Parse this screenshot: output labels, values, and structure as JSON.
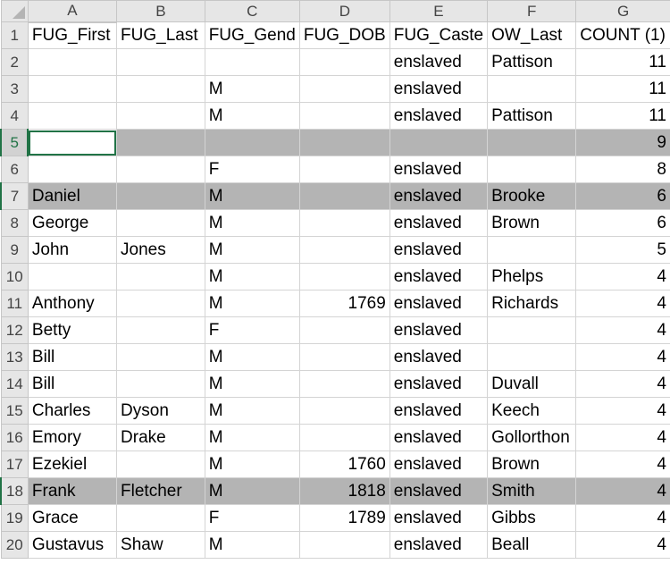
{
  "spreadsheet": {
    "column_headers": [
      "A",
      "B",
      "C",
      "D",
      "E",
      "F",
      "G"
    ],
    "row_numbers": [
      "1",
      "2",
      "3",
      "4",
      "5",
      "6",
      "7",
      "8",
      "9",
      "10",
      "11",
      "12",
      "13",
      "14",
      "15",
      "16",
      "17",
      "18",
      "19",
      "20"
    ],
    "rows": [
      [
        "FUG_First",
        "FUG_Last",
        "FUG_Gend",
        "FUG_DOB",
        "FUG_Caste",
        "OW_Last",
        "COUNT (1)"
      ],
      [
        "",
        "",
        "",
        "",
        "enslaved",
        "Pattison",
        "11"
      ],
      [
        "",
        "",
        "M",
        "",
        "enslaved",
        "",
        "11"
      ],
      [
        "",
        "",
        "M",
        "",
        "enslaved",
        "Pattison",
        "11"
      ],
      [
        "",
        "",
        "",
        "",
        "",
        "",
        "9"
      ],
      [
        "",
        "",
        "F",
        "",
        "enslaved",
        "",
        "8"
      ],
      [
        "Daniel",
        "",
        "M",
        "",
        "enslaved",
        "Brooke",
        "6"
      ],
      [
        "George",
        "",
        "M",
        "",
        "enslaved",
        "Brown",
        "6"
      ],
      [
        "John",
        "Jones",
        "M",
        "",
        "enslaved",
        "",
        "5"
      ],
      [
        "",
        "",
        "M",
        "",
        "enslaved",
        "Phelps",
        "4"
      ],
      [
        "Anthony",
        "",
        "M",
        "1769",
        "enslaved",
        "Richards",
        "4"
      ],
      [
        "Betty",
        "",
        "F",
        "",
        "enslaved",
        "",
        "4"
      ],
      [
        "Bill",
        "",
        "M",
        "",
        "enslaved",
        "",
        "4"
      ],
      [
        "Bill",
        "",
        "M",
        "",
        "enslaved",
        "Duvall",
        "4"
      ],
      [
        "Charles",
        "Dyson",
        "M",
        "",
        "enslaved",
        "Keech",
        "4"
      ],
      [
        "Emory",
        "Drake",
        "M",
        "",
        "enslaved",
        "Gollorthon",
        "4"
      ],
      [
        "Ezekiel",
        "",
        "M",
        "1760",
        "enslaved",
        "Brown",
        "4"
      ],
      [
        "Frank",
        "Fletcher",
        "M",
        "1818",
        "enslaved",
        "Smith",
        "4"
      ],
      [
        "Grace",
        "",
        "F",
        "1789",
        "enslaved",
        "Gibbs",
        "4"
      ],
      [
        "Gustavus",
        "Shaw",
        "M",
        "",
        "enslaved",
        "Beall",
        "4"
      ]
    ],
    "highlighted_rows": [
      5,
      7,
      18
    ],
    "active_cell": "A5",
    "colors": {
      "highlight": "#b4b4b4",
      "header": "#e6e6e6",
      "selection": "#217346",
      "gridline": "#d4d4d4"
    }
  }
}
